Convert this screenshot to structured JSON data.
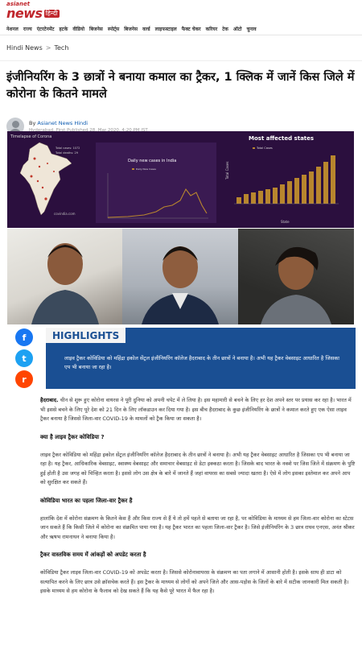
{
  "logo": {
    "top": "asianet",
    "main": "news",
    "badge": "हिन्दी"
  },
  "nav": [
    "नेशनल",
    "राज्य",
    "एंटरटेनमेंट",
    "हटके",
    "वीडियो",
    "बिजनेस",
    "स्पोर्ट्स",
    "बिजनेस",
    "वर्ल्ड",
    "लाइफस्टाइल",
    "फैक्ट चेकर",
    "करियर",
    "टेक",
    "ऑटो",
    "चुनाव"
  ],
  "breadcrumb": {
    "root": "Hindi News",
    "sep": ">",
    "current": "Tech"
  },
  "headline": "इंजीनियरिंग के 3 छात्रों ने बनाया कमाल का ट्रैकर, 1 क्लिक में जानें किस जिले में कोरोना के कितने मामले",
  "byline": {
    "prefix": "By ",
    "author": "Asianet News Hindi",
    "date": "Hyderabad, First Published 28, Mar 2020, 4:20 PM IST"
  },
  "infographic": {
    "map_title": "Timelapse of Corona",
    "map_stats": [
      "Total cases: 1072",
      "Total deaths: 29"
    ],
    "map_source": "covindia.com",
    "line_title": "Daily new cases in India",
    "line_legend": "Daily New Cases",
    "bar_title": "Most affected states",
    "bar_legend": "Total Cases",
    "bar_xlabel": "State",
    "bar_ylabel": "Total Cases",
    "colors": {
      "bg": "#2b0f3e",
      "accent": "#b8862e"
    }
  },
  "share": {
    "fb": "f",
    "tw": "t",
    "rd": "r"
  },
  "highlights": {
    "title": "HIGHLIGHTS",
    "text": "लाइव ट्रैकर कोविडिया को महिंद्रा इकोल सेंट्रल इंजीनियरिंग कॉलेज हैदराबाद के तीन छात्रों ने बनाया है। अभी यह ट्रैकर वेबसाइट आधारित है जिसका एप भी बनाया जा रहा है।"
  },
  "article": {
    "p1_lead": "हैदराबाद.",
    "p1": " चीन से शुरू हुए कोरोना वायरस ने पूरी दुनिया को अपनी चपेट में ले लिया है। इस महामारी से बचने के लिए हर देश अपने स्तर पर प्रयास कर रहा है। भारत में भी इससे बचने के लिए पूरे देश को 21 दिन के लिए लॉकडाउन कर दिया गया है। इस बीच हैदराबाद के कुछ इंजीनियरिंग के छात्रों ने कमाल करते हुए एक ऐसा लाइव ट्रैकर बनाया है जिससे जिला-वार COVID-19 के मामलों को ट्रैक किया जा सकता है।",
    "h1": "क्या है लाइव ट्रैकर कोविडिया ?",
    "p2": "लाइव ट्रैकर कोविडिया को महिंद्रा इकोल सेंट्रल इंजीनियरिंग कॉलेज हैदराबाद के तीन छात्रों ने बनाया है। अभी यह ट्रैकर वेबसाइट आधारित है जिसका एप भी बनाया जा रहा है। यह ट्रैकर, आधिकारिक वेबसाइट, स्वास्थ्य वेबसाइट और समाचार वेबसाइट से डेटा इक्कठा करता है। जिसके बाद भारत के नक्शे पर जिस जिले में संक्रमण के पुष्टि हुई होती है उस जगह को चिन्हित करता है। इससे लोग उस क्षेत्र के बारे में जानते हैं जहां वायरस का सबसे ज्यादा खतरा है। ऐसे में लोग इसका इस्तेमाल कर अपने आप को सुरक्षित कर सकते हैं।",
    "h2": "कोविडिया भारत का पहला जिला-वार ट्रैकर है",
    "p3": "हालांकि देश में कोरोना संक्रमण के कितने केस हैं और किस राज्य से हैं ये तो हमें पहले से बताया जा रहा है, पर कोविडिया के माध्यम से हम जिला-वार कोरोना का स्टेटस जान सकते हैं कि किसी जिले में कोरोना का संक्रमित पाया गया है। यह ट्रैकर भारत का पहला जिला-वार ट्रैकर है। जिसे इंजीनियरिंग के 3 छात्र राघव एनएस, अनंत श्रीकर और ऋषभ रामनाथन ने बनाया किया है।",
    "h3": "ट्रैकर वास्तविक समय में आंकड़ों को अपडेट करता है",
    "p4": "कोविडिया ट्रैकर लाइव जिला-वार COVID-19 को अपडेट करता है। जिससे कोरोनावायरस के संक्रमण का पता लगाने में आसानी होती है। इसके साथ ही डाटा को सत्यापित करने के लिए छात्र उसे क्रॉसचेक करते हैं। इस ट्रैकर के माध्यम से लोगों को अपने जिले और आस-पड़ोस के जिलों के बारे में सटीक जानकारी मिल सकती है। इसके माध्यम से हम कोरोना के फैलाव को देख सकते हैं कि यह कैसे पूरे भारत में फैल रहा है।"
  }
}
